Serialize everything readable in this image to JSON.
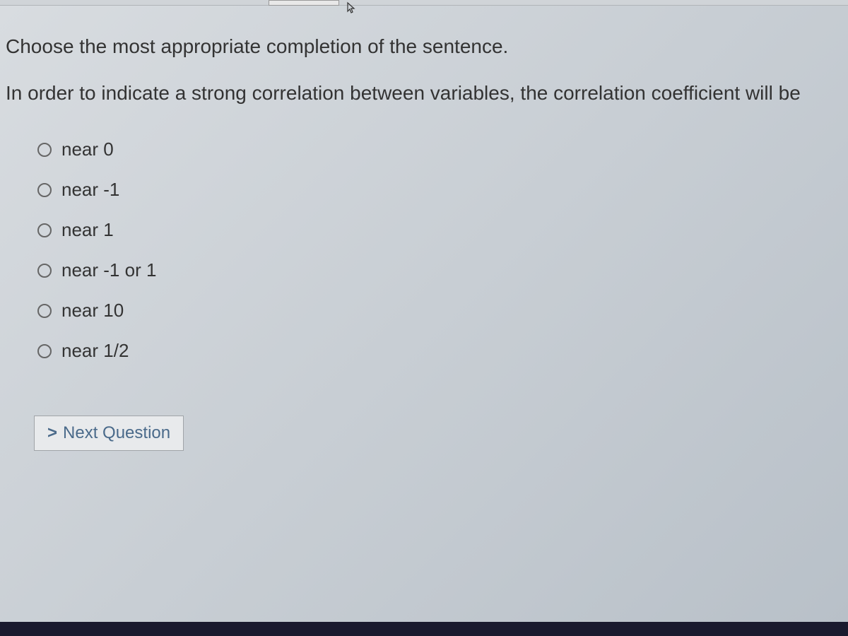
{
  "prompt": "Choose the most appropriate completion of the sentence.",
  "question": "In order to indicate a strong correlation between variables, the correlation coefficient will be",
  "options": [
    {
      "label": "near 0"
    },
    {
      "label": "near -1"
    },
    {
      "label": "near 1"
    },
    {
      "label": "near -1 or 1"
    },
    {
      "label": "near 10"
    },
    {
      "label": "near 1/2"
    }
  ],
  "buttons": {
    "next": "Next Question"
  }
}
